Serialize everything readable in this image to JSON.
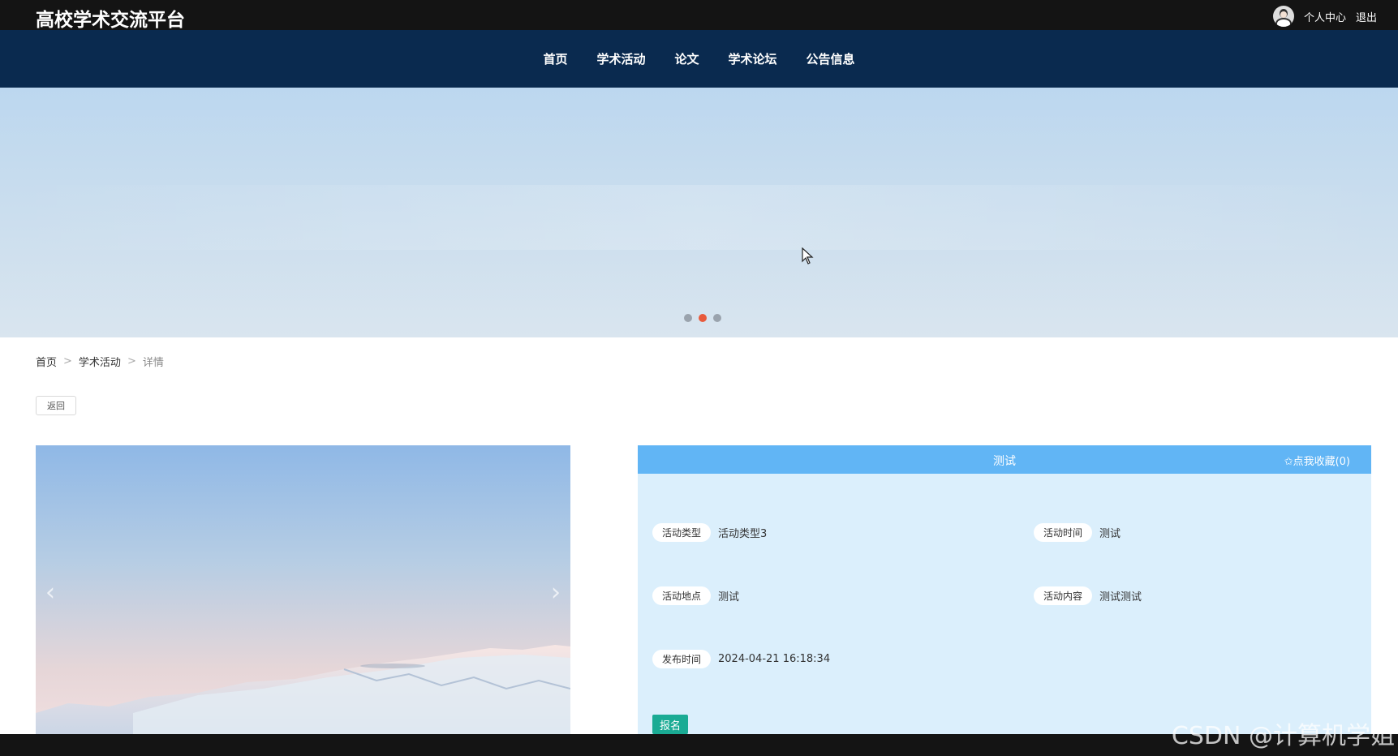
{
  "app": {
    "title": "高校学术交流平台",
    "user_center": "个人中心",
    "logout": "退出"
  },
  "nav": {
    "items": [
      "首页",
      "学术活动",
      "论文",
      "学术论坛",
      "公告信息"
    ]
  },
  "banner": {
    "dot_count": 3,
    "active_dot_index": 1
  },
  "breadcrumb": {
    "home": "首页",
    "section": "学术活动",
    "current": "详情",
    "separator": ">"
  },
  "back_button": "返回",
  "detail": {
    "title": "测试",
    "favorite": "✩点我收藏(0)",
    "fields": [
      {
        "label": "活动类型",
        "value": "活动类型3"
      },
      {
        "label": "活动时间",
        "value": "测试"
      },
      {
        "label": "活动地点",
        "value": "测试"
      },
      {
        "label": "活动内容",
        "value": "测试测试"
      },
      {
        "label": "发布时间",
        "value": "2024-04-21 16:18:34"
      }
    ],
    "signup_button": "报名"
  },
  "watermark": "CSDN @计算机学姐",
  "colors": {
    "topbar": "#141414",
    "nav": "#0a2a4f",
    "detail_header": "#61b5f5",
    "detail_body": "#dbeffc",
    "signup": "#1aab94",
    "active_dot": "#e85a3c"
  }
}
